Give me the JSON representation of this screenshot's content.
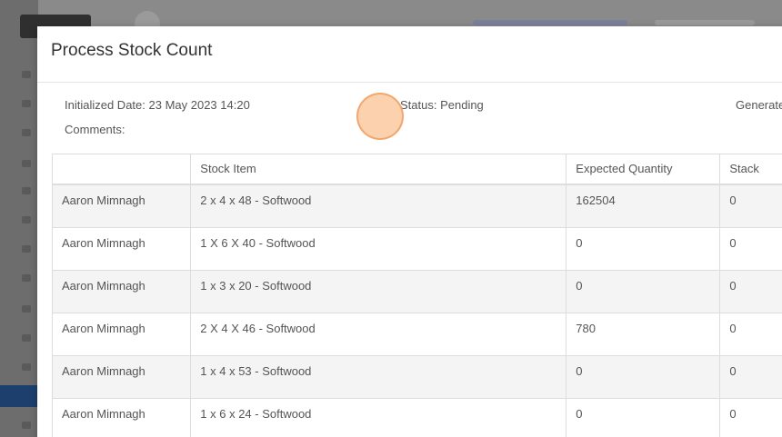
{
  "modal": {
    "title": "Process Stock Count",
    "initialized_label": "Initialized Date: 23 May 2023 14:20",
    "status_label": "Status: Pending",
    "generated_label": "Generated",
    "comments_label": "Comments:"
  },
  "table": {
    "headers": [
      "",
      "Stock Item",
      "Expected Quantity",
      "Stack"
    ],
    "rows": [
      {
        "user": "Aaron Mimnagh",
        "item": "2 x 4 x 48 - Softwood",
        "expected": "162504",
        "stack": "0"
      },
      {
        "user": "Aaron Mimnagh",
        "item": "1 X 6 X 40 - Softwood",
        "expected": "0",
        "stack": "0"
      },
      {
        "user": "Aaron Mimnagh",
        "item": "1 x 3 x 20 - Softwood",
        "expected": "0",
        "stack": "0"
      },
      {
        "user": "Aaron Mimnagh",
        "item": "2 X 4 X 46 - Softwood",
        "expected": "780",
        "stack": "0"
      },
      {
        "user": "Aaron Mimnagh",
        "item": "1 x 4 x 53 - Softwood",
        "expected": "0",
        "stack": "0"
      },
      {
        "user": "Aaron Mimnagh",
        "item": "1 x 6 x 24 - Softwood",
        "expected": "0",
        "stack": "0"
      }
    ]
  },
  "colors": {
    "overlay": "#7a7a7a",
    "active_nav": "#1c3f6e",
    "row_stripe": "#f4f4f4",
    "click_marker": "#fabe8c"
  }
}
